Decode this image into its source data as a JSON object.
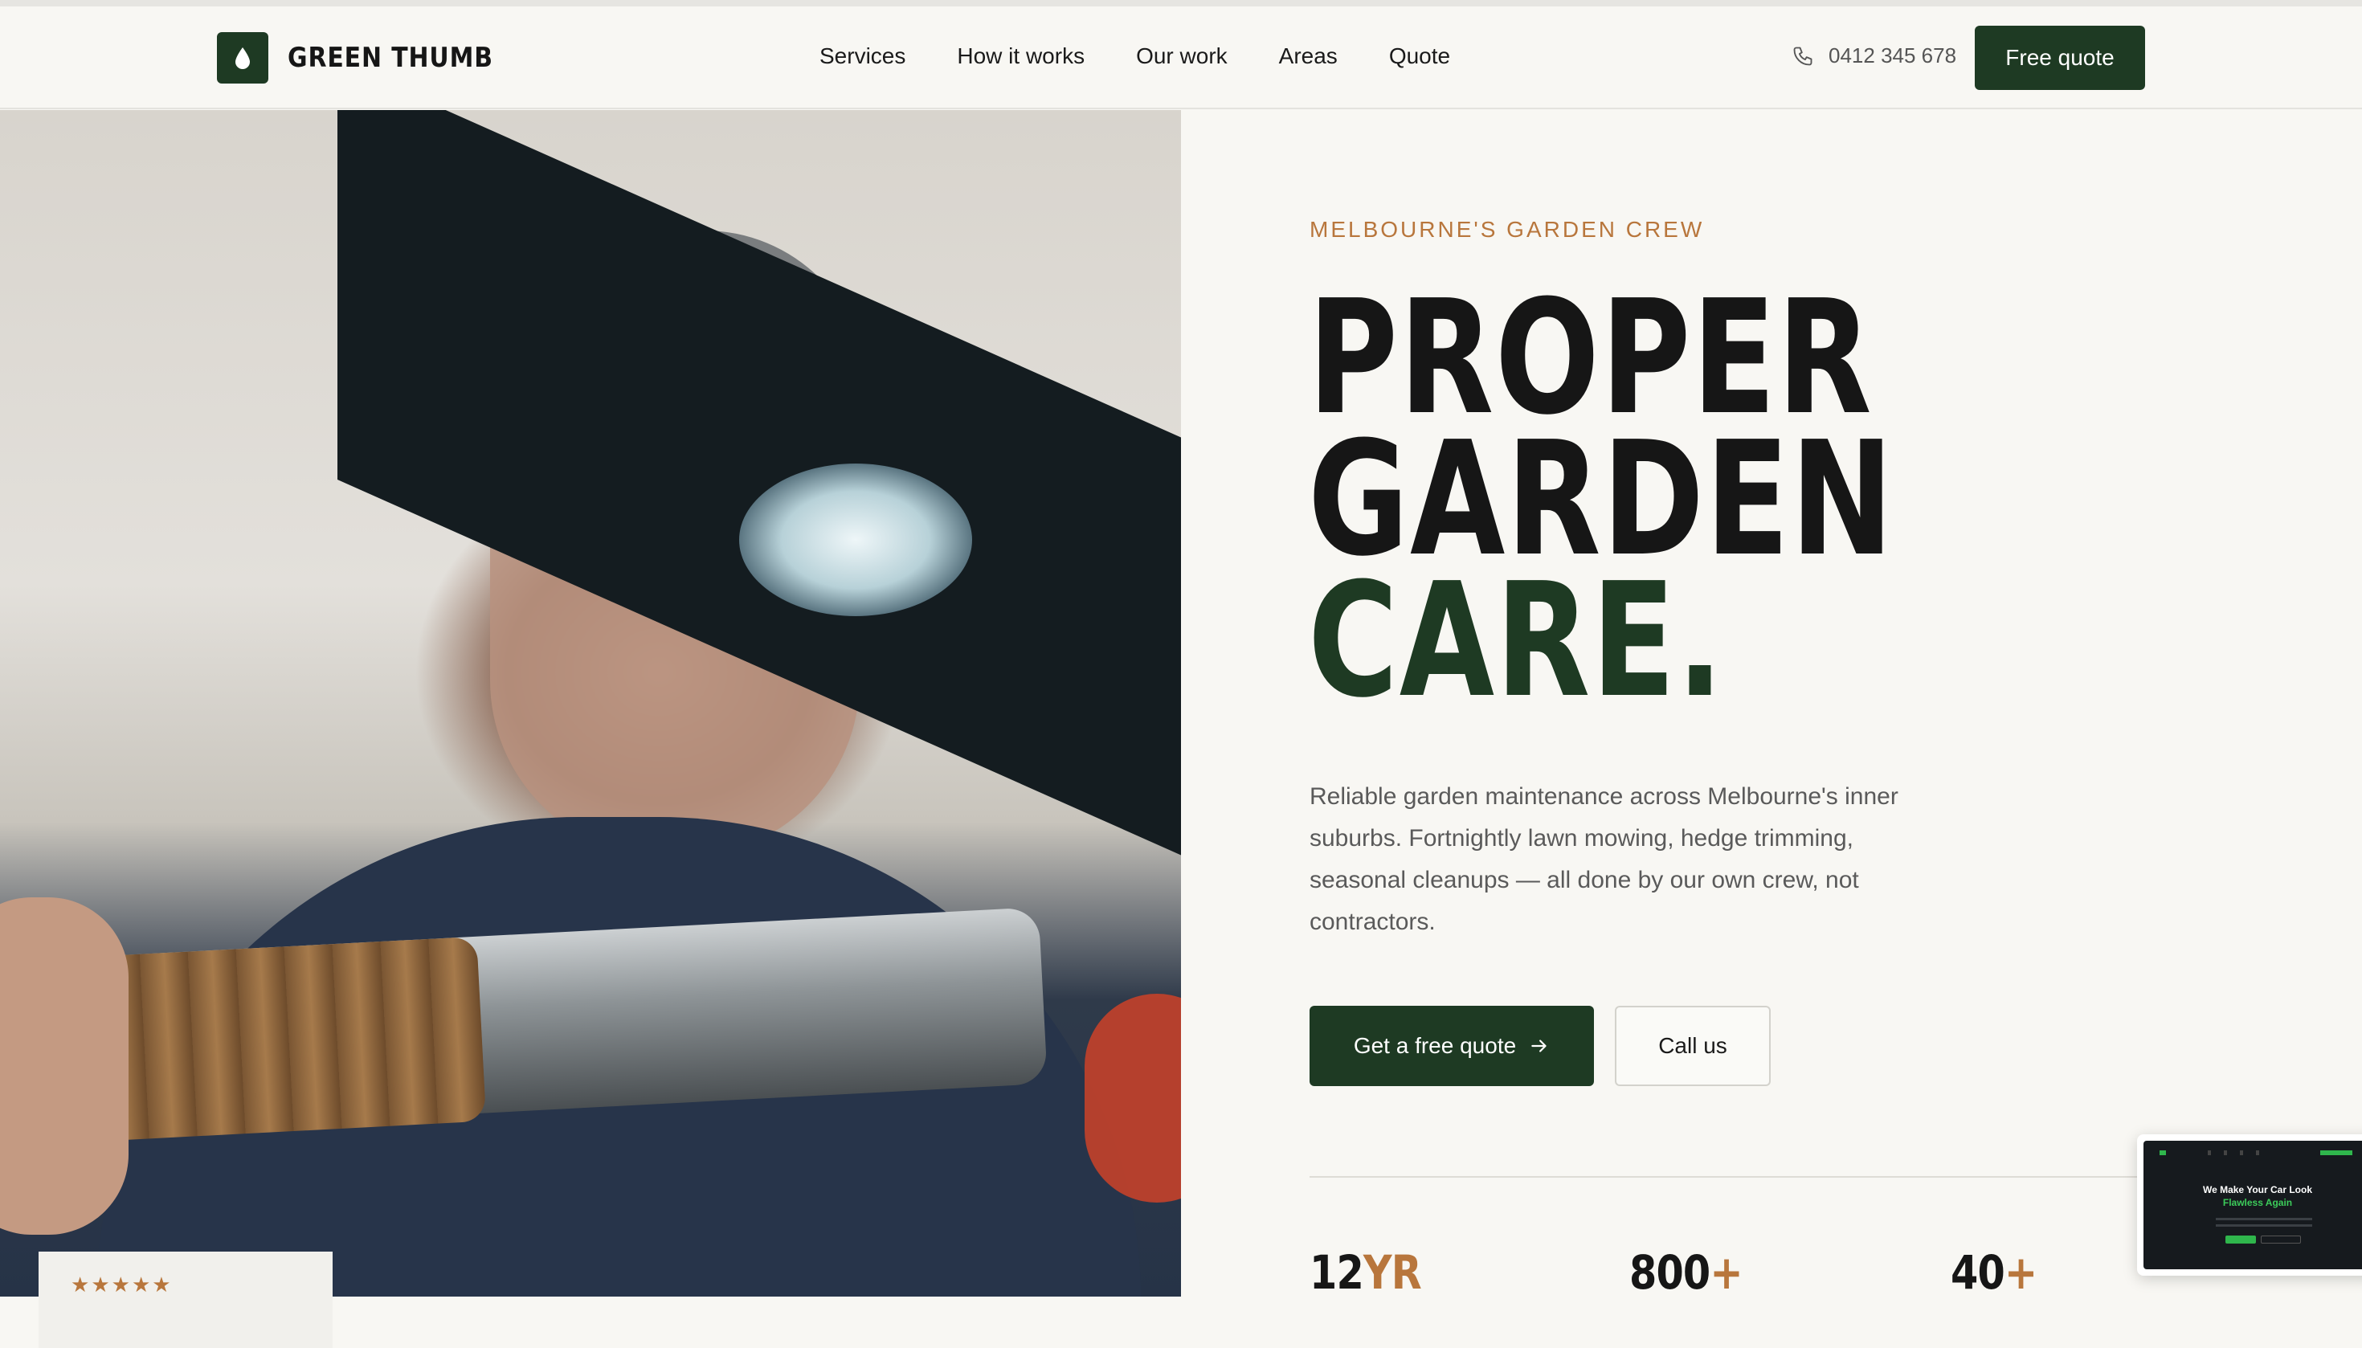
{
  "brand": {
    "name": "GREEN THUMB",
    "icon": "water-drop-icon",
    "color": "#1e3a23"
  },
  "nav": {
    "items": [
      "Services",
      "How it works",
      "Our work",
      "Areas",
      "Quote"
    ]
  },
  "header": {
    "phone": "0412 345 678",
    "phone_icon": "phone-icon",
    "cta": "Free quote"
  },
  "hero": {
    "eyebrow": "MELBOURNE'S GARDEN CREW",
    "headline": [
      "PROPER",
      "GARDEN",
      "CARE."
    ],
    "description": "Reliable garden maintenance across Melbourne's inner suburbs. Fortnightly lawn mowing, hedge trimming, seasonal cleanups — all done by our own crew, not contractors.",
    "primary_cta": "Get a free quote",
    "secondary_cta": "Call us",
    "accent_color": "#b8763c"
  },
  "rating": {
    "stars": 5
  },
  "stats": [
    {
      "value": "12",
      "suffix": "YR"
    },
    {
      "value": "800",
      "suffix": "+"
    },
    {
      "value": "40",
      "suffix": "+"
    }
  ],
  "preview": {
    "title": "We Make Your Car Look",
    "subtitle": "Flawless Again"
  }
}
